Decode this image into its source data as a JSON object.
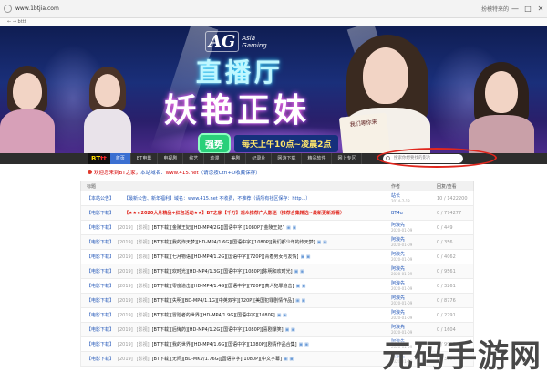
{
  "browser": {
    "url": "www.1btjia.com",
    "sub": "← → bttt",
    "right_label": "扮模特来的",
    "controls": [
      "—",
      "□",
      "✕"
    ]
  },
  "banner": {
    "ag_mark": "AG",
    "ag_text_1": "Asia",
    "ag_text_2": "Gaming",
    "headline1": "直播厅",
    "headline2": "妖艳正妹",
    "promo_tag": "强势",
    "promo_text": "每天上午10点~凌晨2点",
    "sign_text": "我们等你来"
  },
  "nav": {
    "logo_a": "BT",
    "logo_b": "tt",
    "items": [
      "首页",
      "BT电影",
      "电视剧",
      "综艺",
      "动漫",
      "美剧",
      "纪录片",
      "网游下载",
      "精品软件",
      "网上专区"
    ],
    "search_placeholder": "搜索你想要找的影片"
  },
  "notice": {
    "text1": "欢迎您来到BT之家，",
    "text2": "本站域名：",
    "text3": "www.415.net",
    "text4": "（请您按Ctrl+D收藏保存）"
  },
  "table": {
    "header": {
      "title": "标题",
      "author": "作者",
      "stats": "回复/查看"
    },
    "rows": [
      {
        "cat": "【本站公告】",
        "date": "",
        "date2": "",
        "title": "【最新公告、新年福利】域名：www.415.net 不收费，不推荐（请所有社区保存：http...）",
        "style": "blue",
        "imgs": "",
        "author": "站长",
        "author_date": "2014-7-18",
        "stats": "10 / 1422200"
      },
      {
        "cat": "【电影下载】",
        "date": "",
        "date2": "",
        "title": "【★★★2020大片精品+红包活动★★】BT之家【千万】观众推荐广大影迷（推荐合集精选~最新更新观看）",
        "style": "red",
        "imgs": "",
        "author": "BT4u",
        "author_date": "",
        "stats": "0 / 774277"
      },
      {
        "cat": "【电影下载】",
        "date": "[2019]",
        "date2": "[影视]",
        "title": "[BT下载][金陵王妃][HD-MP4/2G][国语中字][1080P]“金陵王妃”",
        "style": "",
        "imgs": "▣ ▣",
        "author": "阿浪先",
        "author_date": "2020-01-09",
        "stats": "0 / 449"
      },
      {
        "cat": "【电影下载】",
        "date": "[2019]",
        "date2": "[影视]",
        "title": "[BT下载][我的炸天梦][HD-MP4/1.6G][国语中字][1080P][我们都少年的炸天梦]",
        "style": "",
        "imgs": "▣ ▣",
        "author": "阿浪先",
        "author_date": "2020-01-09",
        "stats": "0 / 356"
      },
      {
        "cat": "【电影下载】",
        "date": "[2019]",
        "date2": "[影视]",
        "title": "[BT下载][七月物语][HD-MP4/1.2G][国语中字][720P][青春男女与友情]",
        "style": "",
        "imgs": "▣ ▣",
        "author": "阿浪先",
        "author_date": "2020-01-09",
        "stats": "0 / 4062"
      },
      {
        "cat": "【电影下载】",
        "date": "[2019]",
        "date2": "[影视]",
        "title": "[BT下载][欢时光][HD-MP4/1.3G][国语中字][1080P][陈明和欢时光]",
        "style": "",
        "imgs": "▣ ▣",
        "author": "阿浪先",
        "author_date": "2020-01-09",
        "stats": "0 / 9561"
      },
      {
        "cat": "【电影下载】",
        "date": "[2019]",
        "date2": "[影视]",
        "title": "[BT下载][零度追击][HD-MP4/1.4G][国语中字][720P][真人犯罪追击]",
        "style": "",
        "imgs": "▣ ▣",
        "author": "阿浪先",
        "author_date": "2020-01-09",
        "stats": "0 / 3261"
      },
      {
        "cat": "【电影下载】",
        "date": "[2019]",
        "date2": "[影视]",
        "title": "[BT下载][失明][BD-MP4/1.1G][中英双字][720P][美国犯罪剧情作品]",
        "style": "",
        "imgs": "▣ ▣",
        "author": "阿浪先",
        "author_date": "2020-01-09",
        "stats": "0 / 8776"
      },
      {
        "cat": "【电影下载】",
        "date": "[2019]",
        "date2": "[影视]",
        "title": "[BT下载][冒险者的世界][HD-MP4/1.9G][国语中字][1080P]",
        "style": "",
        "imgs": "▣ ▣",
        "author": "阿浪先",
        "author_date": "2020-01-09",
        "stats": "0 / 2791"
      },
      {
        "cat": "【电影下载】",
        "date": "[2019]",
        "date2": "[影视]",
        "title": "[BT下载][后悔药][HD-MP4/1.2G][国语中字][1080P][喜剧爆笑]",
        "style": "",
        "imgs": "▣ ▣",
        "author": "阿浪先",
        "author_date": "2020-01-09",
        "stats": "0 / 1604"
      },
      {
        "cat": "【电影下载】",
        "date": "[2019]",
        "date2": "[影视]",
        "title": "[BT下载][我的世界][HD-MP4/1.6G][国语中字][1080P][剧情作品合集]",
        "style": "",
        "imgs": "▣ ▣",
        "author": "阿浪先",
        "author_date": "2020-01-09",
        "stats": "0 / 9913"
      },
      {
        "cat": "【电影下载】",
        "date": "[2019]",
        "date2": "[影视]",
        "title": "[BT下载][无间][BD-MKV/1.76G][国语中字][1080P][中文字幕]",
        "style": "",
        "imgs": "▣ ▣",
        "author": "阿浪先",
        "author_date": "2020-01-09",
        "stats": "0 / 3354"
      }
    ]
  },
  "watermark": "元码手游网"
}
